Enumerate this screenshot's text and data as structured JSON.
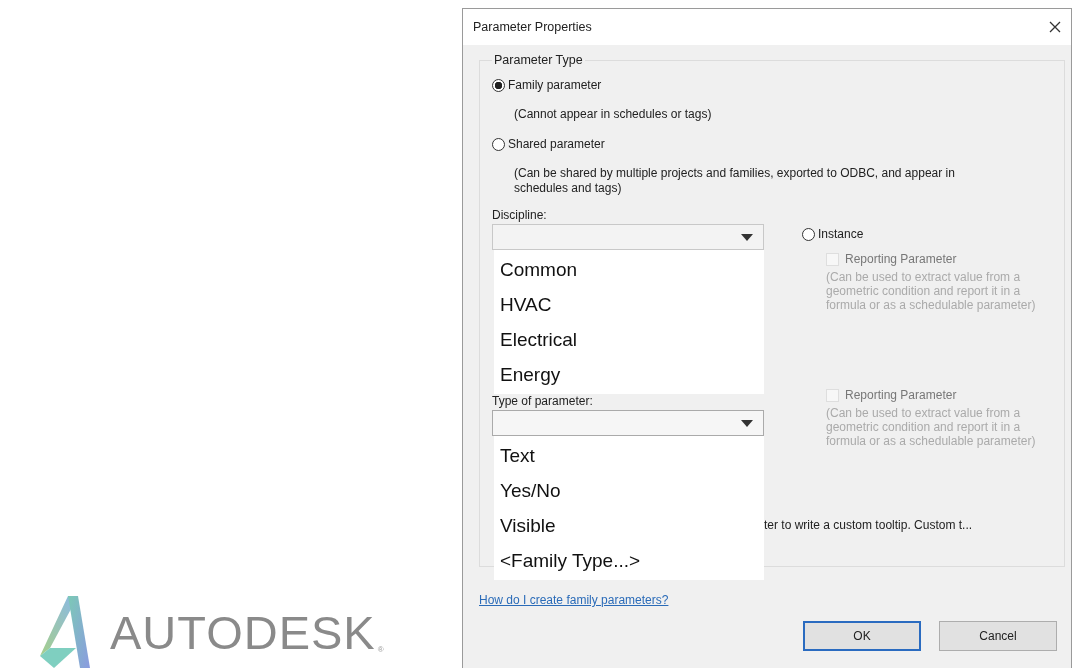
{
  "logo": {
    "wordmark": "AUTODESK",
    "mark": "®"
  },
  "dialog": {
    "title": "Parameter Properties",
    "parameter_type": {
      "label": "Parameter Type",
      "options": [
        {
          "label": "Family parameter",
          "note": "(Cannot appear in schedules or tags)",
          "selected": true
        },
        {
          "label": "Shared parameter",
          "note": "(Can be shared by multiple projects and families, exported to ODBC, and appear in schedules and tags)",
          "selected": false
        }
      ]
    },
    "discipline": {
      "label": "Discipline:",
      "list_open": true,
      "options": [
        "Common",
        "HVAC",
        "Electrical",
        "Energy"
      ]
    },
    "type_of_parameter": {
      "label": "Type of parameter:",
      "list_open": true,
      "options": [
        "Text",
        "Yes/No",
        "Visible",
        "<Family Type...>"
      ]
    },
    "instance": {
      "label": "Instance",
      "selected": false
    },
    "reporting": [
      {
        "label": "Reporting Parameter",
        "checked": false,
        "disabled": true,
        "note": "(Can be used to extract value from a geometric condition and report it in a formula or as a schedulable parameter)"
      },
      {
        "label": "Reporting Parameter",
        "checked": false,
        "disabled": true,
        "note": "(Can be used to extract value from a geometric condition and report it in a formula or as a schedulable parameter)"
      }
    ],
    "tooltip_fragment": "ter to write a custom tooltip. Custom t...",
    "help_link": "How do I create family parameters?",
    "buttons": [
      {
        "label": "OK",
        "default": true
      },
      {
        "label": "Cancel",
        "default": false
      }
    ]
  }
}
